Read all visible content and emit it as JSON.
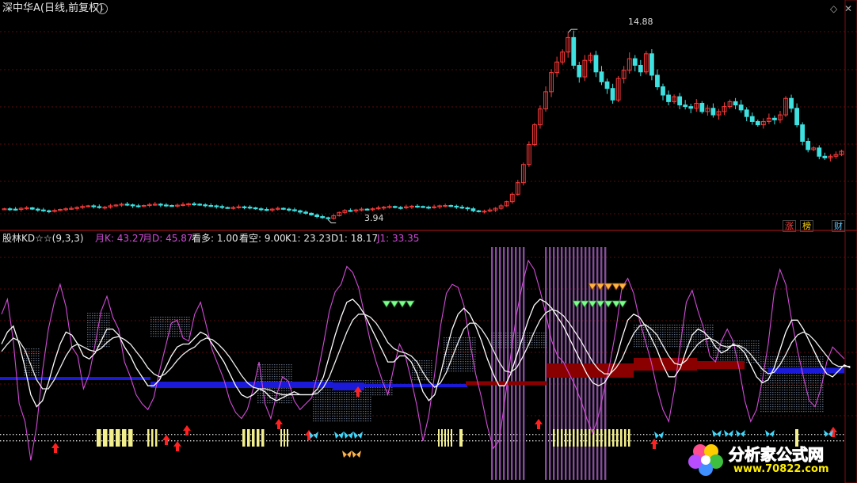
{
  "title": "深中华A(日线,前复权)",
  "indicator": {
    "name": "股林KD☆☆",
    "params": "(9,3,3)",
    "readouts": [
      {
        "label": "月K:",
        "value": "43.27",
        "color": "#d24bd8"
      },
      {
        "label": "月D:",
        "value": "45.87",
        "color": "#d24bd8"
      },
      {
        "label": "看多:",
        "value": "1.00",
        "color": "#e6e6e6"
      },
      {
        "label": "看空:",
        "value": "9.00",
        "color": "#e6e6e6"
      },
      {
        "label": "K1:",
        "value": "23.23",
        "color": "#e6e6e6"
      },
      {
        "label": "D1:",
        "value": "18.17",
        "color": "#e6e6e6"
      },
      {
        "label": "J1:",
        "value": "33.35",
        "color": "#d24bd8"
      }
    ]
  },
  "tags": [
    {
      "label": "涨",
      "color": "#ff4040"
    },
    {
      "label": "榜",
      "color": "#ffd400"
    },
    {
      "label": "财",
      "color": "#5ec8ff"
    }
  ],
  "watermark": {
    "brand": "分析家公式网",
    "url": "www.70822.com"
  },
  "colors": {
    "up": "#ff3b3b",
    "down": "#3fe0e0",
    "kd_white": "#ffffff",
    "kd_purple": "#d24bd8",
    "blue_band": "#1a1ad8",
    "red_band": "#8a0000",
    "yellow_bars": "#f3ef8c",
    "purple_bars": "#9b59b6"
  },
  "chart_data": [
    {
      "type": "candlestick",
      "label_high": "14.88",
      "label_low": "3.94",
      "ylim": [
        3.5,
        16
      ],
      "closes": [
        4.52,
        4.5,
        4.48,
        4.55,
        4.58,
        4.5,
        4.45,
        4.4,
        4.38,
        4.42,
        4.48,
        4.52,
        4.55,
        4.6,
        4.66,
        4.7,
        4.65,
        4.6,
        4.62,
        4.7,
        4.75,
        4.8,
        4.76,
        4.7,
        4.68,
        4.72,
        4.78,
        4.8,
        4.75,
        4.72,
        4.7,
        4.74,
        4.78,
        4.82,
        4.8,
        4.76,
        4.72,
        4.7,
        4.66,
        4.6,
        4.58,
        4.6,
        4.64,
        4.62,
        4.58,
        4.52,
        4.48,
        4.45,
        4.5,
        4.55,
        4.5,
        4.46,
        4.4,
        4.32,
        4.25,
        4.15,
        4.05,
        3.98,
        3.94,
        4.1,
        4.3,
        4.42,
        4.4,
        4.45,
        4.5,
        4.48,
        4.52,
        4.58,
        4.62,
        4.66,
        4.6,
        4.58,
        4.64,
        4.68,
        4.66,
        4.62,
        4.6,
        4.64,
        4.7,
        4.72,
        4.68,
        4.62,
        4.58,
        4.52,
        4.4,
        4.35,
        4.38,
        4.45,
        4.55,
        4.7,
        4.95,
        5.4,
        6.1,
        7.2,
        8.4,
        9.6,
        10.56,
        11.6,
        12.76,
        13.4,
        14.0,
        14.88,
        13.2,
        12.5,
        13.5,
        13.8,
        12.8,
        12.2,
        11.8,
        11.1,
        12.4,
        12.9,
        13.6,
        13.2,
        12.8,
        13.9,
        12.6,
        11.9,
        11.4,
        11.0,
        11.3,
        10.8,
        10.7,
        10.6,
        10.9,
        10.4,
        10.6,
        10.2,
        10.4,
        10.7,
        11.0,
        10.8,
        10.5,
        10.1,
        9.8,
        9.6,
        9.8,
        10.0,
        9.9,
        10.2,
        11.2,
        10.6,
        9.6,
        8.6,
        8.1,
        8.2,
        7.7,
        7.6,
        7.7,
        7.8,
        8.0
      ]
    },
    {
      "type": "line",
      "ylim": [
        -30,
        125
      ],
      "series": [
        {
          "name": "月K",
          "color": "#d24bd8",
          "values": [
            80,
            90,
            62,
            20,
            8,
            -18,
            5,
            42,
            70,
            88,
            100,
            85,
            58,
            52,
            30,
            40,
            60,
            82,
            92,
            78,
            70,
            48,
            38,
            26,
            20,
            16,
            24,
            42,
            58,
            74,
            76,
            64,
            62,
            80,
            88,
            72,
            56,
            46,
            36,
            22,
            14,
            10,
            16,
            30,
            48,
            20,
            10,
            26,
            38,
            35,
            22,
            16,
            20,
            24,
            40,
            60,
            82,
            95,
            100,
            112,
            108,
            98,
            80,
            62,
            48,
            36,
            26,
            44,
            60,
            52,
            36,
            18,
            -5,
            12,
            40,
            72,
            94,
            100,
            98,
            86,
            62,
            40,
            24,
            5,
            -10,
            -5,
            22,
            52,
            80,
            100,
            116,
            110,
            96,
            80,
            62,
            52,
            48,
            40,
            32,
            22,
            10,
            0,
            12,
            30,
            48,
            70,
            98,
            104,
            94,
            76,
            62,
            48,
            30,
            16,
            8,
            30,
            60,
            88,
            96,
            82,
            70,
            52,
            48,
            62,
            70,
            62,
            44,
            22,
            8,
            16,
            36,
            60,
            94,
            110,
            100,
            76,
            56,
            38,
            22,
            18,
            30,
            48,
            58,
            54,
            50
          ]
        },
        {
          "name": "K1",
          "color": "#ffffff",
          "values": [
            60,
            68,
            72,
            60,
            44,
            26,
            18,
            22,
            34,
            48,
            60,
            68,
            66,
            60,
            52,
            50,
            54,
            62,
            70,
            70,
            66,
            58,
            52,
            44,
            38,
            32,
            32,
            36,
            44,
            52,
            58,
            60,
            60,
            64,
            68,
            66,
            60,
            54,
            48,
            40,
            32,
            26,
            24,
            26,
            30,
            28,
            24,
            22,
            24,
            26,
            28,
            26,
            26,
            26,
            30,
            38,
            52,
            66,
            78,
            88,
            90,
            86,
            80,
            72,
            64,
            56,
            48,
            48,
            52,
            52,
            48,
            40,
            28,
            22,
            26,
            40,
            56,
            70,
            80,
            84,
            80,
            72,
            62,
            50,
            40,
            32,
            32,
            40,
            52,
            64,
            76,
            86,
            90,
            88,
            84,
            78,
            72,
            64,
            56,
            48,
            40,
            34,
            32,
            34,
            40,
            50,
            64,
            76,
            80,
            78,
            72,
            64,
            56,
            46,
            38,
            38,
            44,
            56,
            66,
            70,
            68,
            64,
            58,
            54,
            56,
            60,
            58,
            54,
            46,
            38,
            34,
            36,
            44,
            56,
            68,
            76,
            76,
            70,
            62,
            54,
            46,
            40,
            38,
            42,
            46,
            44
          ]
        },
        {
          "name": "D1",
          "color": "#f0f0f0",
          "values": [
            55,
            60,
            64,
            62,
            56,
            46,
            36,
            30,
            30,
            36,
            44,
            52,
            58,
            60,
            58,
            56,
            55,
            57,
            61,
            64,
            65,
            63,
            60,
            55,
            50,
            44,
            40,
            38,
            40,
            44,
            49,
            53,
            56,
            58,
            62,
            64,
            63,
            60,
            56,
            51,
            45,
            39,
            34,
            31,
            30,
            30,
            29,
            27,
            26,
            26,
            26,
            26,
            26,
            26,
            27,
            31,
            38,
            48,
            58,
            68,
            76,
            80,
            80,
            78,
            74,
            68,
            61,
            57,
            55,
            54,
            52,
            48,
            41,
            35,
            31,
            34,
            41,
            51,
            61,
            70,
            74,
            74,
            70,
            64,
            56,
            48,
            42,
            41,
            44,
            51,
            59,
            68,
            76,
            81,
            83,
            82,
            79,
            74,
            68,
            62,
            55,
            48,
            43,
            40,
            40,
            44,
            50,
            59,
            67,
            72,
            73,
            70,
            66,
            59,
            52,
            47,
            46,
            49,
            55,
            60,
            63,
            64,
            62,
            59,
            58,
            59,
            59,
            57,
            53,
            48,
            43,
            40,
            41,
            46,
            53,
            61,
            66,
            68,
            66,
            62,
            57,
            52,
            47,
            45,
            45,
            45
          ]
        }
      ],
      "bands": [
        {
          "name": "blue",
          "color": "#1a1ad8"
        },
        {
          "name": "red",
          "color": "#8a0000"
        }
      ]
    }
  ]
}
